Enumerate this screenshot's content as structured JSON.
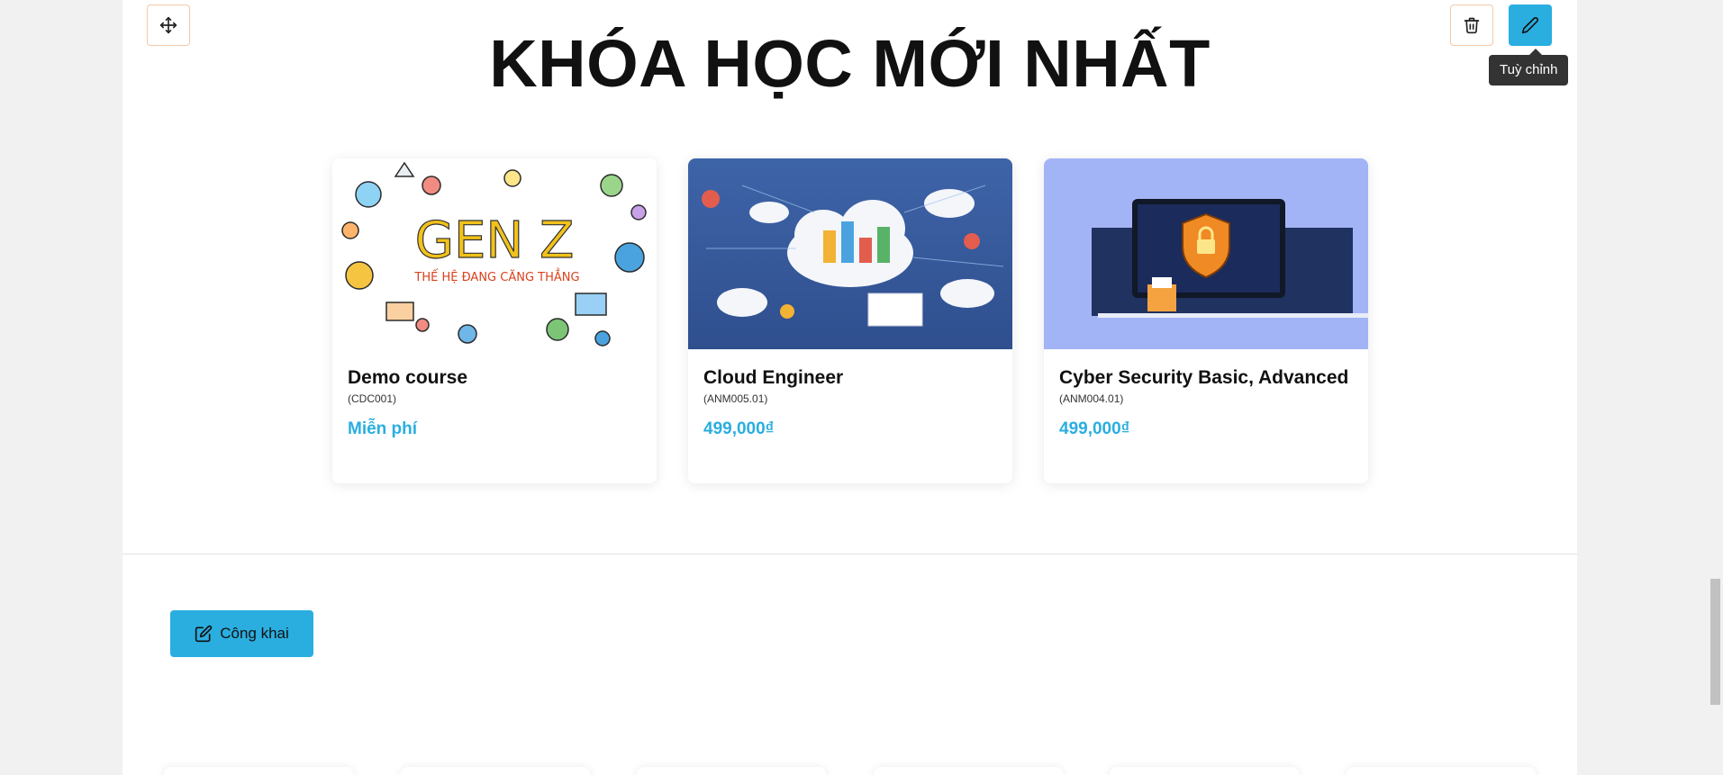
{
  "section": {
    "title": "KHÓA HỌC MỚI NHẤT"
  },
  "toolbar": {
    "tooltip": "Tuỳ chỉnh"
  },
  "courses": [
    {
      "title": "Demo course",
      "code": "(CDC001)",
      "price": "Miễn phí",
      "image_text_main": "GEN Z",
      "image_text_sub": "THẾ HỆ ĐANG CĂNG THẲNG"
    },
    {
      "title": "Cloud Engineer",
      "code": "(ANM005.01)",
      "price": "499,000₫"
    },
    {
      "title": "Cyber Security Basic, Advanced",
      "code": "(ANM004.01)",
      "price": "499,000₫"
    }
  ],
  "publish": {
    "label": "Công khai"
  },
  "colors": {
    "accent": "#2aaee0",
    "tooltip_bg": "#333333"
  }
}
